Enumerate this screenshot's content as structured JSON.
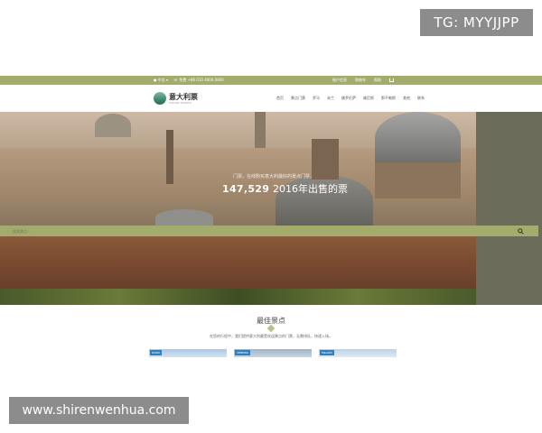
{
  "watermarks": {
    "tg": "TG: MYYJJPP",
    "site": "www.shirenwenhua.com"
  },
  "topbar": {
    "left_items": [
      "● 中文 ▾",
      "☏ 免费 +86 010 4006 0800"
    ],
    "right_items": [
      "账户信息",
      "购物车",
      "帮助"
    ],
    "cart_icon": "cart-icon"
  },
  "header": {
    "logo_title": "意大利票",
    "logo_subtitle": "ITALIAN TICKETS",
    "nav": [
      "首页",
      "景点门票",
      "罗马",
      "米兰",
      "佛罗伦萨",
      "威尼斯",
      "那不勒斯",
      "其他",
      "联系"
    ]
  },
  "hero": {
    "tagline": "门票，在线购买意大利最好的景点门票。",
    "count": "147,529",
    "count_suffix": "2016年出售的票",
    "search_placeholder": "搜索景点...",
    "search_icon": "search-icon"
  },
  "section": {
    "title": "最佳景点",
    "description": "在您的行程中，我们提供意大利最受欢迎景点的门票，无需排队，快速入场。",
    "card_tags": [
      "ROMA",
      "VENEZIA",
      "MILANO"
    ]
  },
  "colors": {
    "accent": "#a3ac6c",
    "card_tag": "#2f7fbf"
  }
}
